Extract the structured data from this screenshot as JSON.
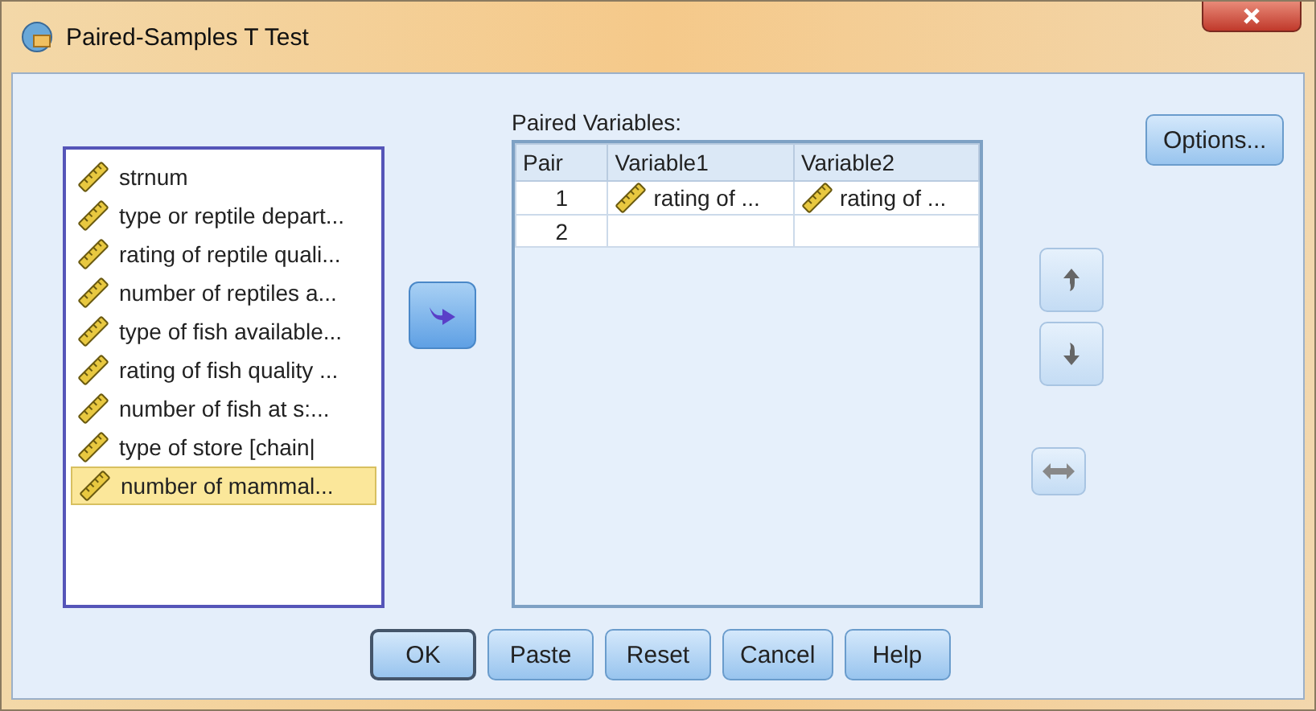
{
  "window": {
    "title": "Paired-Samples T Test"
  },
  "variables": [
    {
      "name": "strnum",
      "selected": false
    },
    {
      "name": "type or reptile depart...",
      "selected": false
    },
    {
      "name": "rating of reptile quali...",
      "selected": false
    },
    {
      "name": "number of reptiles a...",
      "selected": false
    },
    {
      "name": "type of fish available...",
      "selected": false
    },
    {
      "name": "rating of fish quality ...",
      "selected": false
    },
    {
      "name": "number of fish at s:...",
      "selected": false
    },
    {
      "name": "type of store [chain|",
      "selected": false
    },
    {
      "name": "number of mammal...",
      "selected": true
    }
  ],
  "paired_variables": {
    "label": "Paired Variables:",
    "columns": [
      "Pair",
      "Variable1",
      "Variable2"
    ],
    "rows": [
      {
        "pair": "1",
        "variable1": "rating of ...",
        "variable2": "rating of ..."
      },
      {
        "pair": "2",
        "variable1": "",
        "variable2": ""
      }
    ]
  },
  "options_button": "Options...",
  "buttons": [
    {
      "label": "OK",
      "default": true
    },
    {
      "label": "Paste",
      "default": false
    },
    {
      "label": "Reset",
      "default": false
    },
    {
      "label": "Cancel",
      "default": false
    },
    {
      "label": "Help",
      "default": false
    }
  ]
}
